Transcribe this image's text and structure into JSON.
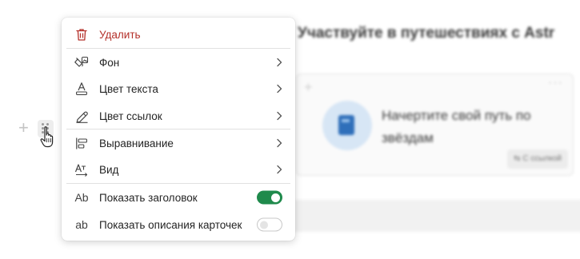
{
  "background": {
    "title": "Участвуйте в путешествиях с Astr",
    "card_text": "Начертите свой путь по звёздам",
    "card_button": "⇆ С ссылкой"
  },
  "menu": {
    "delete": {
      "label": "Удалить",
      "icon": "trash-icon",
      "color": "#b4302a"
    },
    "items": [
      {
        "label": "Фон",
        "icon": "paint-bucket-icon"
      },
      {
        "label": "Цвет текста",
        "icon": "text-color-icon"
      },
      {
        "label": "Цвет ссылок",
        "icon": "pen-icon"
      },
      {
        "label": "Выравнивание",
        "icon": "align-left-icon"
      },
      {
        "label": "Вид",
        "icon": "text-direction-icon"
      }
    ],
    "toggles": [
      {
        "icon_text": "Ab",
        "label": "Показать заголовок",
        "on": true
      },
      {
        "icon_text": "ab",
        "label": "Показать описания карточек",
        "on": false
      }
    ],
    "toggle_on_color": "#1f8a4c"
  }
}
